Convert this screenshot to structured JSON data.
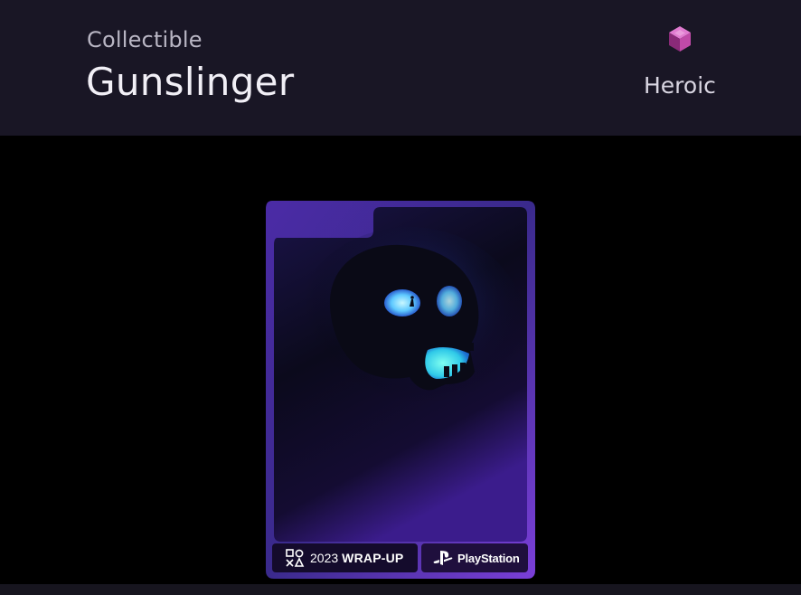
{
  "header": {
    "category": "Collectible",
    "title": "Gunslinger",
    "rarity": {
      "label": "Heroic",
      "icon": "rarity-cube-icon",
      "color": "#b03c9a"
    }
  },
  "card": {
    "art_icon": "skull-icon",
    "accent_color": "#7b3fe0",
    "glow_color": "#3ec6ff",
    "footer": {
      "wrap_year": "2023",
      "wrap_text": "WRAP-UP",
      "brand": "PlayStation",
      "wrap_icon": "wrap-up-glyph-icon",
      "brand_icon": "playstation-logo-icon"
    }
  }
}
